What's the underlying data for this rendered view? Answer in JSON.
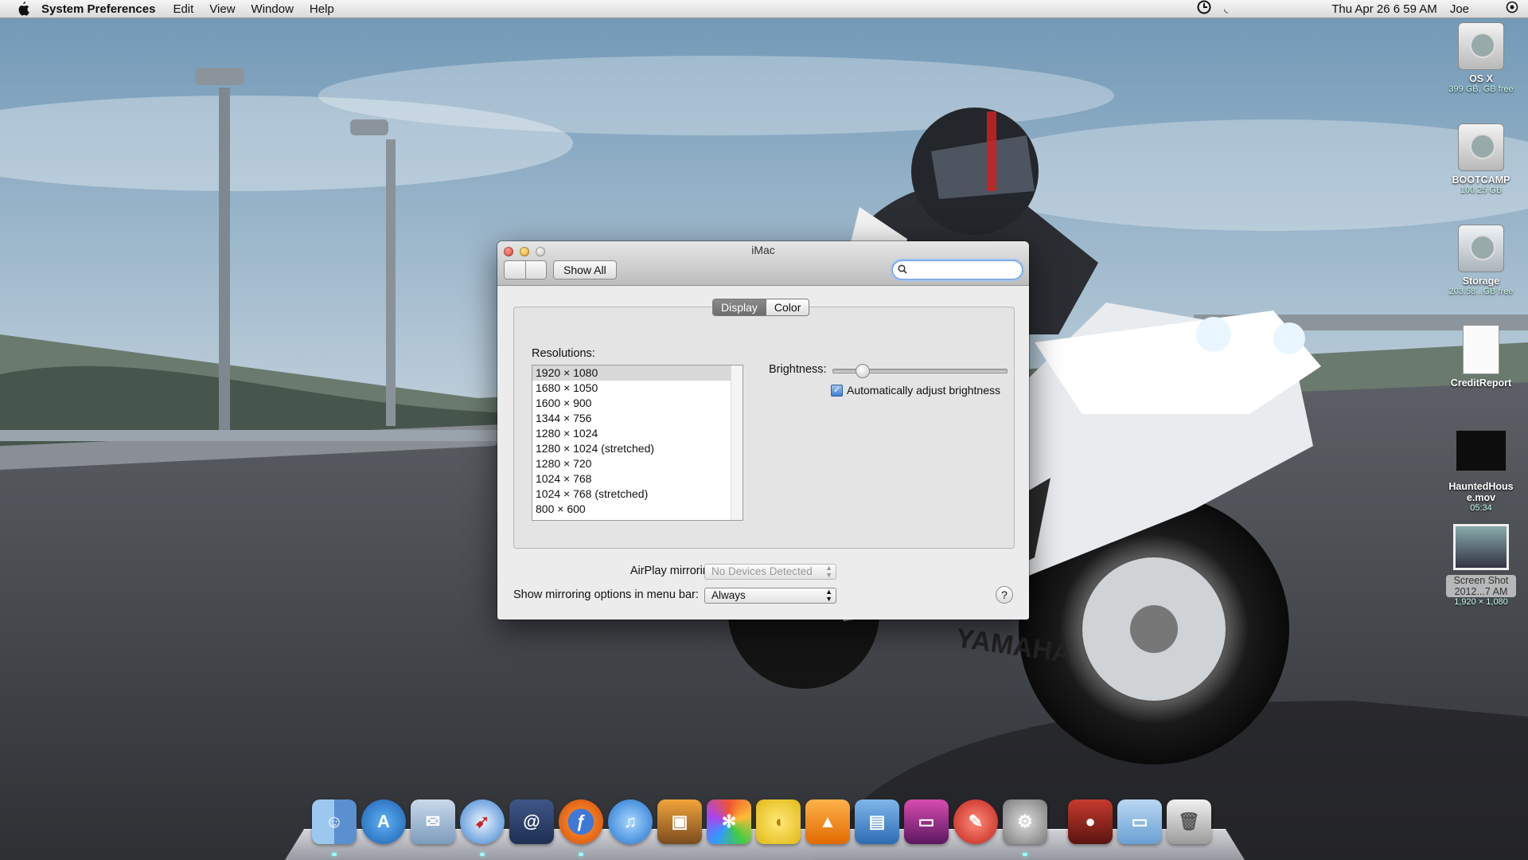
{
  "menubar": {
    "app_name": "System Preferences",
    "menus": [
      "Edit",
      "View",
      "Window",
      "Help"
    ],
    "clock": "Thu Apr 26  6 59 AM",
    "user": "Joe"
  },
  "desktop_icons": [
    {
      "label": "OS X",
      "sub": "399 GB, GB free",
      "icon": "hard-drive-icon"
    },
    {
      "label": "BOOTCAMP",
      "sub": "100.25 GB",
      "icon": "hard-drive-icon"
    },
    {
      "label": "Storage",
      "sub": "203.58...GB free",
      "icon": "time-machine-drive-icon"
    },
    {
      "label": "CreditReport",
      "sub": "",
      "icon": "document-icon"
    },
    {
      "label": "HauntedHous e.mov",
      "sub": "05:34",
      "icon": "movie-file-icon"
    },
    {
      "label": "Screen Shot 2012...7 AM",
      "sub": "1,920 × 1,080",
      "icon": "screenshot-file-icon"
    }
  ],
  "window": {
    "title": "iMac",
    "show_all": "Show All",
    "search_placeholder": "",
    "tabs": {
      "display": "Display",
      "color": "Color",
      "selected": "Display"
    },
    "resolutions_label": "Resolutions:",
    "resolutions": [
      "1920 × 1080",
      "1680 × 1050",
      "1600 × 900",
      "1344 × 756",
      "1280 × 1024",
      "1280 × 1024 (stretched)",
      "1280 × 720",
      "1024 × 768",
      "1024 × 768 (stretched)",
      "800 × 600"
    ],
    "selected_resolution": "1920 × 1080",
    "brightness_label": "Brightness:",
    "brightness_level": 0.14,
    "auto_brightness_label": "Automatically adjust brightness",
    "auto_brightness_checked": true,
    "airplay_label": "AirPlay mirroring:",
    "airplay_value": "No Devices Detected",
    "mirroring_label": "Show mirroring options in menu bar:",
    "mirroring_value": "Always",
    "help": "?"
  },
  "dock": [
    "finder-icon",
    "app-store-icon",
    "mail-icon",
    "safari-icon",
    "address-book-icon",
    "firefox-icon",
    "itunes-icon",
    "iphoto-icon",
    "pinwheel-icon",
    "cyberduck-icon",
    "vlc-icon",
    "preview-icon",
    "imac-icon",
    "cleanmymac-icon",
    "system-preferences-icon",
    "angry-birds-icon",
    "folder-icon",
    "trash-icon"
  ]
}
